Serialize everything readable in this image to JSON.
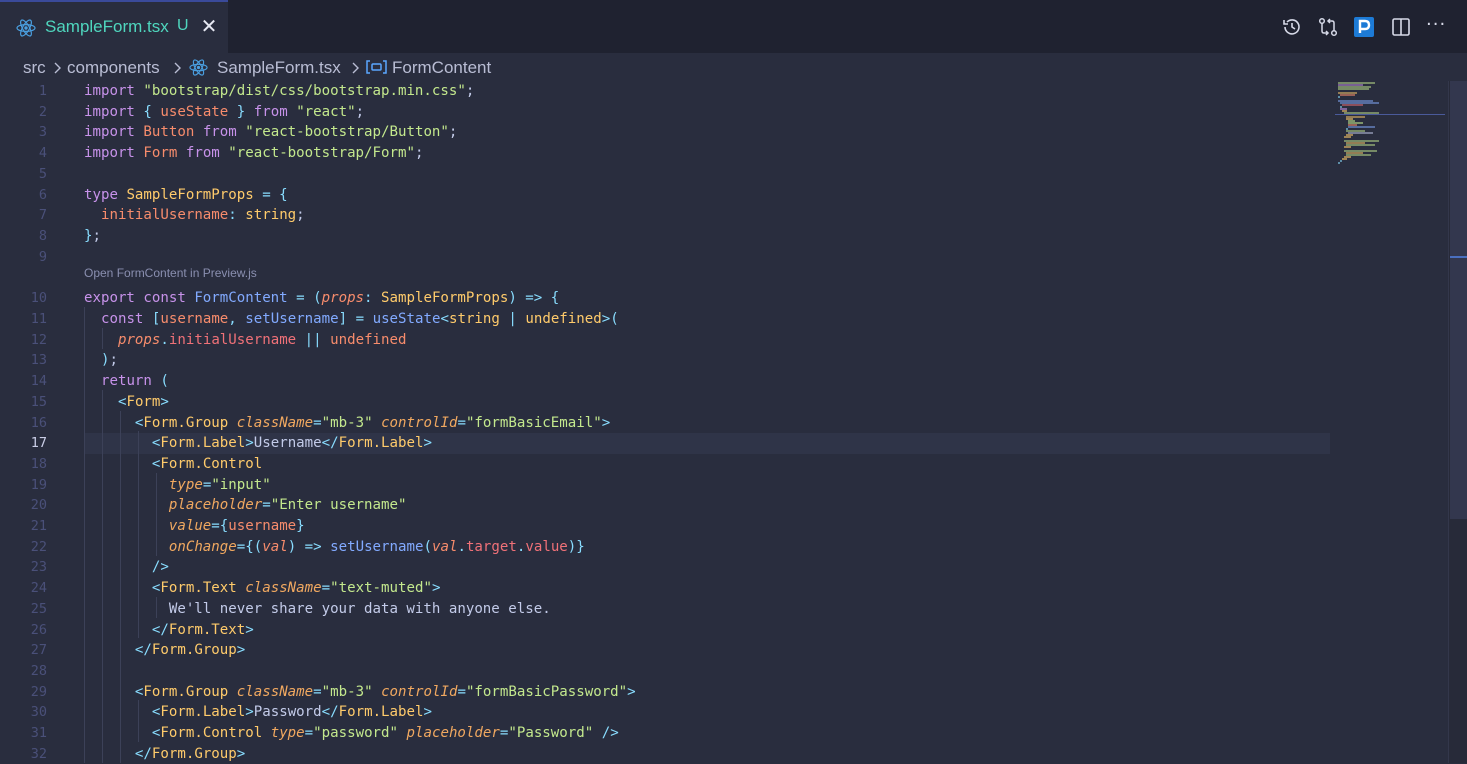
{
  "tab": {
    "title": "SampleForm.tsx",
    "status": "U",
    "close": "✕",
    "icon": "react-icon"
  },
  "actions": [
    "history-icon",
    "compare-icon",
    "p-icon",
    "split-editor-icon",
    "more-icon"
  ],
  "actions_more": "···",
  "breadcrumb": {
    "src": "src",
    "components": "components",
    "file": "SampleForm.tsx",
    "symbol": "FormContent"
  },
  "codelens": "Open FormContent in Preview.js",
  "active_line": 17,
  "lines": [
    {
      "n": "1",
      "t": [
        [
          "kw",
          "import "
        ],
        [
          "str",
          "\"bootstrap/dist/css/bootstrap.min.css\""
        ],
        [
          "tx",
          ";"
        ]
      ]
    },
    {
      "n": "2",
      "t": [
        [
          "kw",
          "import "
        ],
        [
          "pu",
          "{ "
        ],
        [
          "id",
          "useState"
        ],
        [
          "pu",
          " } "
        ],
        [
          "kw",
          "from "
        ],
        [
          "str",
          "\"react\""
        ],
        [
          "tx",
          ";"
        ]
      ]
    },
    {
      "n": "3",
      "t": [
        [
          "kw",
          "import "
        ],
        [
          "id",
          "Button "
        ],
        [
          "kw",
          "from "
        ],
        [
          "str",
          "\"react-bootstrap/Button\""
        ],
        [
          "tx",
          ";"
        ]
      ]
    },
    {
      "n": "4",
      "t": [
        [
          "kw",
          "import "
        ],
        [
          "id",
          "Form "
        ],
        [
          "kw",
          "from "
        ],
        [
          "str",
          "\"react-bootstrap/Form\""
        ],
        [
          "tx",
          ";"
        ]
      ]
    },
    {
      "n": "5",
      "t": []
    },
    {
      "n": "6",
      "t": [
        [
          "kw",
          "type "
        ],
        [
          "ty",
          "SampleFormProps "
        ],
        [
          "pu",
          "= {"
        ]
      ]
    },
    {
      "n": "7",
      "t": [
        [
          "tx",
          "  "
        ],
        [
          "id",
          "initialUsername"
        ],
        [
          "pu",
          ": "
        ],
        [
          "ty",
          "string"
        ],
        [
          "tx",
          ";"
        ]
      ]
    },
    {
      "n": "8",
      "t": [
        [
          "pu",
          "}"
        ],
        [
          "tx",
          ";"
        ]
      ]
    },
    {
      "n": "9",
      "t": []
    },
    {
      "n": "10",
      "t": [
        [
          "kw",
          "export const "
        ],
        [
          "fn",
          "FormContent "
        ],
        [
          "pu",
          "= ("
        ],
        [
          "it",
          "props"
        ],
        [
          "pu",
          ": "
        ],
        [
          "ty",
          "SampleFormProps"
        ],
        [
          "pu",
          ") => {"
        ]
      ]
    },
    {
      "n": "11",
      "t": [
        [
          "tx",
          "  "
        ],
        [
          "kw",
          "const "
        ],
        [
          "pu",
          "["
        ],
        [
          "id",
          "username"
        ],
        [
          "pu",
          ", "
        ],
        [
          "fn",
          "setUsername"
        ],
        [
          "pu",
          "] = "
        ],
        [
          "fn",
          "useState"
        ],
        [
          "pu",
          "<"
        ],
        [
          "ty",
          "string"
        ],
        [
          "pu",
          " | "
        ],
        [
          "ty",
          "undefined"
        ],
        [
          "pu",
          ">("
        ]
      ]
    },
    {
      "n": "12",
      "t": [
        [
          "tx",
          "    "
        ],
        [
          "it",
          "props"
        ],
        [
          "pu",
          "."
        ],
        [
          "pr",
          "initialUsername"
        ],
        [
          "pu",
          " || "
        ],
        [
          "id",
          "undefined"
        ]
      ]
    },
    {
      "n": "13",
      "t": [
        [
          "tx",
          "  "
        ],
        [
          "pu",
          ")"
        ],
        [
          "tx",
          ";"
        ]
      ]
    },
    {
      "n": "14",
      "t": [
        [
          "tx",
          "  "
        ],
        [
          "kw",
          "return "
        ],
        [
          "pu",
          "("
        ]
      ]
    },
    {
      "n": "15",
      "t": [
        [
          "tx",
          "    "
        ],
        [
          "pu",
          "<"
        ],
        [
          "tg",
          "Form"
        ],
        [
          "pu",
          ">"
        ]
      ]
    },
    {
      "n": "16",
      "t": [
        [
          "tx",
          "      "
        ],
        [
          "pu",
          "<"
        ],
        [
          "tg",
          "Form.Group "
        ],
        [
          "at",
          "className"
        ],
        [
          "pu",
          "="
        ],
        [
          "str",
          "\"mb-3\""
        ],
        [
          "tx",
          " "
        ],
        [
          "at",
          "controlId"
        ],
        [
          "pu",
          "="
        ],
        [
          "str",
          "\"formBasicEmail\""
        ],
        [
          "pu",
          ">"
        ]
      ]
    },
    {
      "n": "17",
      "t": [
        [
          "tx",
          "        "
        ],
        [
          "pu",
          "<"
        ],
        [
          "tg",
          "Form.Label"
        ],
        [
          "pu",
          ">"
        ],
        [
          "tx",
          "Username"
        ],
        [
          "pu",
          "</"
        ],
        [
          "tg",
          "Form.Label"
        ],
        [
          "pu",
          ">"
        ]
      ]
    },
    {
      "n": "18",
      "t": [
        [
          "tx",
          "        "
        ],
        [
          "pu",
          "<"
        ],
        [
          "tg",
          "Form.Control"
        ]
      ]
    },
    {
      "n": "19",
      "t": [
        [
          "tx",
          "          "
        ],
        [
          "at",
          "type"
        ],
        [
          "pu",
          "="
        ],
        [
          "str",
          "\"input\""
        ]
      ]
    },
    {
      "n": "20",
      "t": [
        [
          "tx",
          "          "
        ],
        [
          "at",
          "placeholder"
        ],
        [
          "pu",
          "="
        ],
        [
          "str",
          "\"Enter username\""
        ]
      ]
    },
    {
      "n": "21",
      "t": [
        [
          "tx",
          "          "
        ],
        [
          "at",
          "value"
        ],
        [
          "pu",
          "={"
        ],
        [
          "id",
          "username"
        ],
        [
          "pu",
          "}"
        ]
      ]
    },
    {
      "n": "22",
      "t": [
        [
          "tx",
          "          "
        ],
        [
          "at",
          "onChange"
        ],
        [
          "pu",
          "={("
        ],
        [
          "it",
          "val"
        ],
        [
          "pu",
          ") => "
        ],
        [
          "fn",
          "setUsername"
        ],
        [
          "pu",
          "("
        ],
        [
          "it",
          "val"
        ],
        [
          "pu",
          "."
        ],
        [
          "pr",
          "target"
        ],
        [
          "pu",
          "."
        ],
        [
          "pr",
          "value"
        ],
        [
          "pu",
          ")}"
        ]
      ]
    },
    {
      "n": "23",
      "t": [
        [
          "tx",
          "        "
        ],
        [
          "pu",
          "/>"
        ]
      ]
    },
    {
      "n": "24",
      "t": [
        [
          "tx",
          "        "
        ],
        [
          "pu",
          "<"
        ],
        [
          "tg",
          "Form.Text "
        ],
        [
          "at",
          "className"
        ],
        [
          "pu",
          "="
        ],
        [
          "str",
          "\"text-muted\""
        ],
        [
          "pu",
          ">"
        ]
      ]
    },
    {
      "n": "25",
      "t": [
        [
          "tx",
          "          We'll never share your data with anyone else."
        ]
      ]
    },
    {
      "n": "26",
      "t": [
        [
          "tx",
          "        "
        ],
        [
          "pu",
          "</"
        ],
        [
          "tg",
          "Form.Text"
        ],
        [
          "pu",
          ">"
        ]
      ]
    },
    {
      "n": "27",
      "t": [
        [
          "tx",
          "      "
        ],
        [
          "pu",
          "</"
        ],
        [
          "tg",
          "Form.Group"
        ],
        [
          "pu",
          ">"
        ]
      ]
    },
    {
      "n": "28",
      "t": []
    },
    {
      "n": "29",
      "t": [
        [
          "tx",
          "      "
        ],
        [
          "pu",
          "<"
        ],
        [
          "tg",
          "Form.Group "
        ],
        [
          "at",
          "className"
        ],
        [
          "pu",
          "="
        ],
        [
          "str",
          "\"mb-3\""
        ],
        [
          "tx",
          " "
        ],
        [
          "at",
          "controlId"
        ],
        [
          "pu",
          "="
        ],
        [
          "str",
          "\"formBasicPassword\""
        ],
        [
          "pu",
          ">"
        ]
      ]
    },
    {
      "n": "30",
      "t": [
        [
          "tx",
          "        "
        ],
        [
          "pu",
          "<"
        ],
        [
          "tg",
          "Form.Label"
        ],
        [
          "pu",
          ">"
        ],
        [
          "tx",
          "Password"
        ],
        [
          "pu",
          "</"
        ],
        [
          "tg",
          "Form.Label"
        ],
        [
          "pu",
          ">"
        ]
      ]
    },
    {
      "n": "31",
      "t": [
        [
          "tx",
          "        "
        ],
        [
          "pu",
          "<"
        ],
        [
          "tg",
          "Form.Control "
        ],
        [
          "at",
          "type"
        ],
        [
          "pu",
          "="
        ],
        [
          "str",
          "\"password\""
        ],
        [
          "tx",
          " "
        ],
        [
          "at",
          "placeholder"
        ],
        [
          "pu",
          "="
        ],
        [
          "str",
          "\"Password\""
        ],
        [
          "pu",
          " />"
        ]
      ]
    },
    {
      "n": "32",
      "t": [
        [
          "tx",
          "      "
        ],
        [
          "pu",
          "</"
        ],
        [
          "tg",
          "Form.Group"
        ],
        [
          "pu",
          ">"
        ]
      ]
    }
  ]
}
